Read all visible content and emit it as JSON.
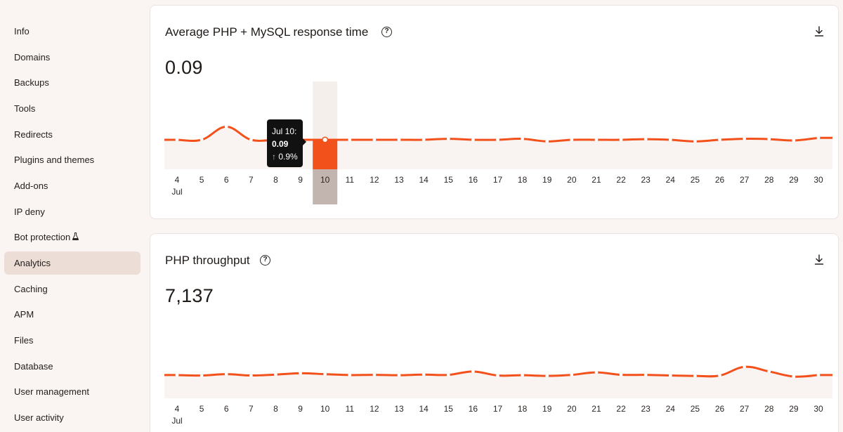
{
  "sidebar": {
    "items": [
      {
        "label": "Info"
      },
      {
        "label": "Domains"
      },
      {
        "label": "Backups"
      },
      {
        "label": "Tools"
      },
      {
        "label": "Redirects"
      },
      {
        "label": "Plugins and themes"
      },
      {
        "label": "Add-ons"
      },
      {
        "label": "IP deny"
      },
      {
        "label": "Bot protection",
        "icon": "flask-icon"
      },
      {
        "label": "Analytics",
        "active": true
      },
      {
        "label": "Caching"
      },
      {
        "label": "APM"
      },
      {
        "label": "Files"
      },
      {
        "label": "Database"
      },
      {
        "label": "User management"
      },
      {
        "label": "User activity"
      }
    ]
  },
  "colors": {
    "accent": "#f2511b",
    "area": "#f9f4f2",
    "highlight_column": "#c2b5b0",
    "tooltip_bg": "#111111"
  },
  "cards": [
    {
      "title": "Average PHP + MySQL response time",
      "value": "0.09",
      "tooltip": {
        "date": "Jul 10:",
        "value": "0.09",
        "arrow": "↑",
        "change": "0.9%"
      }
    },
    {
      "title": "PHP throughput",
      "value": "7,137"
    }
  ],
  "chart_data": [
    {
      "type": "area",
      "title": "Average PHP + MySQL response time",
      "x": [
        "4",
        "5",
        "6",
        "7",
        "8",
        "9",
        "10",
        "11",
        "12",
        "13",
        "14",
        "15",
        "16",
        "17",
        "18",
        "19",
        "20",
        "21",
        "22",
        "23",
        "24",
        "25",
        "26",
        "27",
        "28",
        "29",
        "30"
      ],
      "x_month_label": "Jul",
      "values": [
        0.09,
        0.09,
        0.13,
        0.09,
        0.09,
        0.09,
        0.09,
        0.09,
        0.09,
        0.09,
        0.09,
        0.093,
        0.09,
        0.09,
        0.093,
        0.085,
        0.09,
        0.09,
        0.09,
        0.092,
        0.09,
        0.085,
        0.09,
        0.093,
        0.092,
        0.088,
        0.096
      ],
      "highlighted": {
        "x": "10",
        "value": 0.09,
        "change": "0.9%"
      },
      "ylim": [
        0,
        0.3
      ],
      "grid": false
    },
    {
      "type": "area",
      "title": "PHP throughput",
      "x": [
        "4",
        "5",
        "6",
        "7",
        "8",
        "9",
        "10",
        "11",
        "12",
        "13",
        "14",
        "15",
        "16",
        "17",
        "18",
        "19",
        "20",
        "21",
        "22",
        "23",
        "24",
        "25",
        "26",
        "27",
        "28",
        "29",
        "30"
      ],
      "x_month_label": "Jul",
      "values": [
        260,
        255,
        270,
        255,
        265,
        280,
        270,
        260,
        262,
        258,
        265,
        262,
        300,
        255,
        258,
        250,
        262,
        290,
        263,
        262,
        255,
        250,
        254,
        352,
        300,
        243,
        260
      ],
      "ylim": [
        0,
        1100
      ],
      "grid": false
    }
  ]
}
